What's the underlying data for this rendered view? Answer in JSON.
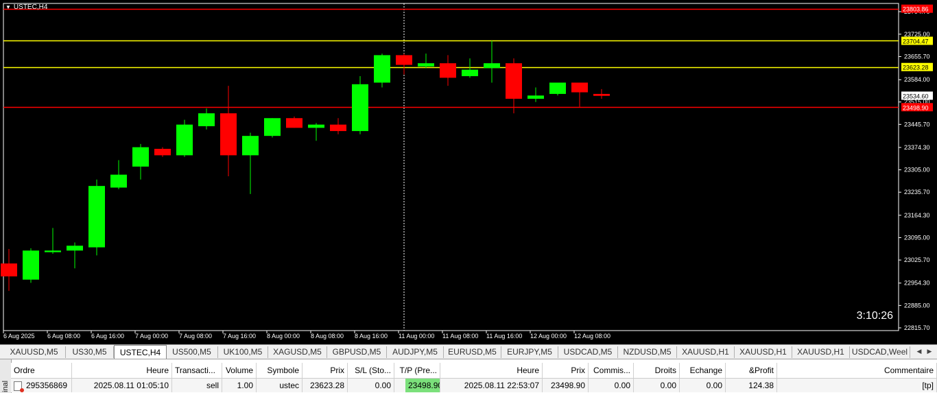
{
  "chart": {
    "symbol": "USTEC,H4",
    "countdown": "3:10:26",
    "price_axis_ticks": [
      "23794.70",
      "23725.00",
      "23655.70",
      "23584.00",
      "23515.00",
      "23445.70",
      "23374.30",
      "23305.00",
      "23235.70",
      "23164.30",
      "23095.00",
      "23025.70",
      "22954.30",
      "22885.00",
      "22815.70"
    ],
    "time_axis_labels": [
      "6 Aug 2025",
      "6 Aug 08:00",
      "6 Aug 16:00",
      "7 Aug 00:00",
      "7 Aug 08:00",
      "7 Aug 16:00",
      "8 Aug 00:00",
      "8 Aug 08:00",
      "8 Aug 16:00",
      "11 Aug 00:00",
      "11 Aug 08:00",
      "11 Aug 16:00",
      "12 Aug 00:00",
      "12 Aug 08:00"
    ],
    "price_range": [
      22800,
      23800
    ],
    "levels": [
      {
        "label": "23803.86",
        "price": 23803.86,
        "color": "#ff0000"
      },
      {
        "label": "23704.47",
        "price": 23704.47,
        "color": "#ffff00"
      },
      {
        "label": "23623.28",
        "price": 23623.28,
        "color": "#ffff00"
      },
      {
        "label": "23534.60",
        "price": 23534.6,
        "color": "#ffffff",
        "bid": true
      },
      {
        "label": "23498.90",
        "price": 23498.9,
        "color": "#ff0000"
      }
    ],
    "crosshair_candle_index": 18,
    "colors": {
      "bull": "#00ff00",
      "bear": "#ff0000",
      "background": "#000000",
      "axis": "#ffffff"
    },
    "candles": [
      {
        "o": 23015,
        "h": 23060,
        "l": 22930,
        "c": 22975
      },
      {
        "o": 22965,
        "h": 23062,
        "l": 22955,
        "c": 23055
      },
      {
        "o": 23050,
        "h": 23125,
        "l": 23045,
        "c": 23055
      },
      {
        "o": 23055,
        "h": 23080,
        "l": 23000,
        "c": 23070
      },
      {
        "o": 23065,
        "h": 23275,
        "l": 23040,
        "c": 23255
      },
      {
        "o": 23250,
        "h": 23335,
        "l": 23245,
        "c": 23290
      },
      {
        "o": 23315,
        "h": 23385,
        "l": 23275,
        "c": 23375
      },
      {
        "o": 23370,
        "h": 23375,
        "l": 23345,
        "c": 23350
      },
      {
        "o": 23350,
        "h": 23460,
        "l": 23345,
        "c": 23445
      },
      {
        "o": 23440,
        "h": 23495,
        "l": 23430,
        "c": 23480
      },
      {
        "o": 23480,
        "h": 23565,
        "l": 23285,
        "c": 23350
      },
      {
        "o": 23350,
        "h": 23420,
        "l": 23230,
        "c": 23410
      },
      {
        "o": 23410,
        "h": 23465,
        "l": 23405,
        "c": 23465
      },
      {
        "o": 23465,
        "h": 23470,
        "l": 23435,
        "c": 23435
      },
      {
        "o": 23435,
        "h": 23450,
        "l": 23395,
        "c": 23445
      },
      {
        "o": 23445,
        "h": 23465,
        "l": 23415,
        "c": 23425
      },
      {
        "o": 23425,
        "h": 23595,
        "l": 23415,
        "c": 23570
      },
      {
        "o": 23575,
        "h": 23665,
        "l": 23560,
        "c": 23660
      },
      {
        "o": 23660,
        "h": 23665,
        "l": 23600,
        "c": 23630
      },
      {
        "o": 23625,
        "h": 23665,
        "l": 23620,
        "c": 23635
      },
      {
        "o": 23635,
        "h": 23660,
        "l": 23565,
        "c": 23590
      },
      {
        "o": 23595,
        "h": 23650,
        "l": 23590,
        "c": 23615
      },
      {
        "o": 23620,
        "h": 23705,
        "l": 23575,
        "c": 23635
      },
      {
        "o": 23635,
        "h": 23650,
        "l": 23480,
        "c": 23525
      },
      {
        "o": 23525,
        "h": 23560,
        "l": 23515,
        "c": 23535
      },
      {
        "o": 23540,
        "h": 23575,
        "l": 23535,
        "c": 23575
      },
      {
        "o": 23575,
        "h": 23575,
        "l": 23500,
        "c": 23545
      },
      {
        "o": 23540,
        "h": 23555,
        "l": 23525,
        "c": 23534
      }
    ]
  },
  "tabs": [
    "XAUUSD,M5",
    "US30,M5",
    "USTEC,H4",
    "US500,M5",
    "UK100,M5",
    "XAGUSD,M5",
    "GBPUSD,M5",
    "AUDJPY,M5",
    "EURUSD,M5",
    "EURJPY,M5",
    "USDCAD,M5",
    "NZDUSD,M5",
    "XAUUSD,H1",
    "XAUUSD,H1",
    "XAUUSD,H1",
    "USDCAD,Weel"
  ],
  "active_tab": 2,
  "terminal": {
    "side_label": "inal",
    "headers": {
      "ordre": "Ordre",
      "heure": "Heure",
      "transaction": "Transacti...",
      "volume": "Volume",
      "symbole": "Symbole",
      "prix": "Prix",
      "sl": "S/L (Sto...",
      "tp": "T/P (Pre...",
      "heure2": "Heure",
      "prix2": "Prix",
      "commission": "Commis...",
      "droits": "Droits",
      "echange": "Echange",
      "profit": "&Profit",
      "commentaire": "Commentaire"
    },
    "row": {
      "ordre": "295356869",
      "heure": "2025.08.11 01:05:10",
      "transaction": "sell",
      "volume": "1.00",
      "symbole": "ustec",
      "prix": "23623.28",
      "sl": "0.00",
      "tp": "23498.90",
      "heure2": "2025.08.11 22:53:07",
      "prix2": "23498.90",
      "commission": "0.00",
      "droits": "0.00",
      "echange": "0.00",
      "profit": "124.38",
      "commentaire": "[tp]"
    }
  }
}
